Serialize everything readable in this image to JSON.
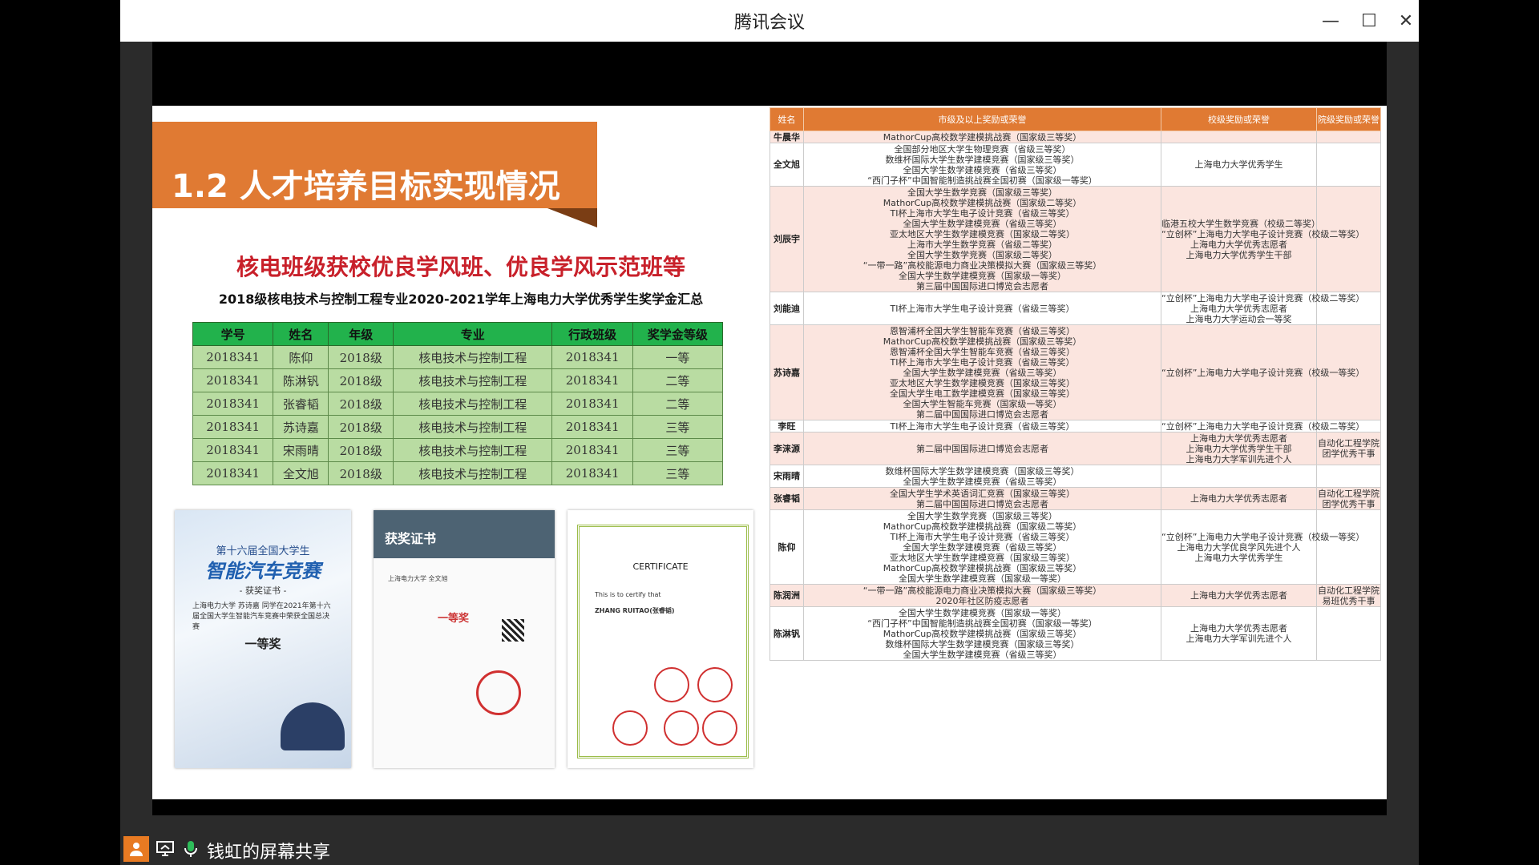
{
  "window": {
    "title": "腾讯会议",
    "minimize": "—",
    "maximize": "☐",
    "close": "✕"
  },
  "slide": {
    "banner_title": "1.2 人才培养目标实现情况",
    "red_heading": "核电班级获校优良学风班、优良学风示范班等",
    "sub_heading": "2018级核电技术与控制工程专业2020-2021学年上海电力大学优秀学生奖学金汇总",
    "scholarship": {
      "headers": [
        "学号",
        "姓名",
        "年级",
        "专业",
        "行政班级",
        "奖学金等级"
      ],
      "rows": [
        [
          "2018341",
          "陈仰",
          "2018级",
          "核电技术与控制工程",
          "2018341",
          "一等"
        ],
        [
          "2018341",
          "陈淋钒",
          "2018级",
          "核电技术与控制工程",
          "2018341",
          "二等"
        ],
        [
          "2018341",
          "张睿韬",
          "2018级",
          "核电技术与控制工程",
          "2018341",
          "二等"
        ],
        [
          "2018341",
          "苏诗嘉",
          "2018级",
          "核电技术与控制工程",
          "2018341",
          "三等"
        ],
        [
          "2018341",
          "宋雨晴",
          "2018级",
          "核电技术与控制工程",
          "2018341",
          "三等"
        ],
        [
          "2018341",
          "全文旭",
          "2018级",
          "核电技术与控制工程",
          "2018341",
          "三等"
        ]
      ]
    },
    "cert1": {
      "top": "第十六届全国大学生",
      "big": "智能汽车竞赛",
      "small": "- 获奖证书 -",
      "text": "上海电力大学 苏诗嘉 同学在2021年第十六届全国大学生智能汽车竞赛中荣获全国总决赛",
      "prize": "一等奖"
    },
    "cert2": {
      "head": "获奖证书",
      "text": "上海电力大学 全文旭",
      "prize": "一等奖"
    },
    "cert3": {
      "title": "CERTIFICATE",
      "text": "This is to certify that",
      "name": "ZHANG RUITAO(张睿韬)"
    },
    "awards": {
      "headers": [
        "姓名",
        "市级及以上奖励或荣誉",
        "校级奖励或荣誉",
        "院级奖励或荣誉"
      ],
      "rows": [
        {
          "name": "牛晨华",
          "city": [
            "MathorCup高校数学建模挑战赛（国家级三等奖）"
          ],
          "school": [],
          "college": []
        },
        {
          "name": "全文旭",
          "city": [
            "全国部分地区大学生物理竞赛（省级三等奖）",
            "数维杯国际大学生数学建模竞赛（国家级三等奖）",
            "全国大学生数学建模竞赛（省级三等奖）",
            "“西门子杯”中国智能制造挑战赛全国初赛（国家级一等奖）"
          ],
          "school": [
            "上海电力大学优秀学生"
          ],
          "college": []
        },
        {
          "name": "刘辰宇",
          "city": [
            "全国大学生数学竞赛（国家级三等奖）",
            "MathorCup高校数学建模挑战赛（国家级二等奖）",
            "TI杯上海市大学生电子设计竞赛（省级三等奖）",
            "全国大学生数学建模竞赛（省级三等奖）",
            "亚太地区大学生数学建模竞赛（国家级二等奖）",
            "上海市大学生数学竞赛（省级二等奖）",
            "全国大学生数学竞赛（国家级二等奖）",
            "“一带一路”高校能源电力商业决策模拟大赛（国家级三等奖）",
            "全国大学生数学建模竞赛（国家级一等奖）",
            "第三届中国国际进口博览会志愿者"
          ],
          "school": [
            "临港五校大学生数学竞赛（校级二等奖）",
            "“立创杯”上海电力大学电子设计竞赛（校级二等奖）",
            "上海电力大学优秀志愿者",
            "上海电力大学优秀学生干部"
          ],
          "college": []
        },
        {
          "name": "刘能迪",
          "city": [
            "TI杯上海市大学生电子设计竞赛（省级三等奖）"
          ],
          "school": [
            "“立创杯”上海电力大学电子设计竞赛（校级二等奖）",
            "上海电力大学优秀志愿者",
            "上海电力大学运动会一等奖"
          ],
          "college": []
        },
        {
          "name": "苏诗嘉",
          "city": [
            "恩智浦杯全国大学生智能车竞赛（省级三等奖）",
            "MathorCup高校数学建模挑战赛（国家级三等奖）",
            "恩智浦杯全国大学生智能车竞赛（省级三等奖）",
            "TI杯上海市大学生电子设计竞赛（省级三等奖）",
            "全国大学生数学建模竞赛（省级三等奖）",
            "亚太地区大学生数学建模竞赛（国家级三等奖）",
            "全国大学生电工数学建模竞赛（国家级三等奖）",
            "全国大学生智能车竞赛（国家级一等奖）",
            "第二届中国国际进口博览会志愿者"
          ],
          "school": [
            "“立创杯”上海电力大学电子设计竞赛（校级一等奖）"
          ],
          "college": []
        },
        {
          "name": "李旺",
          "city": [
            "TI杯上海市大学生电子设计竞赛（省级三等奖）"
          ],
          "school": [
            "“立创杯”上海电力大学电子设计竞赛（校级二等奖）"
          ],
          "college": []
        },
        {
          "name": "李涞源",
          "city": [
            "第二届中国国际进口博览会志愿者"
          ],
          "school": [
            "上海电力大学优秀志愿者",
            "上海电力大学优秀学生干部",
            "上海电力大学军训先进个人"
          ],
          "college": [
            "自动化工程学院",
            "团学优秀干事"
          ]
        },
        {
          "name": "宋雨晴",
          "city": [
            "数维杯国际大学生数学建模竞赛（国家级三等奖）",
            "全国大学生数学建模竞赛（省级三等奖）"
          ],
          "school": [],
          "college": []
        },
        {
          "name": "张睿韬",
          "city": [
            "全国大学生学术英语词汇竞赛（国家级三等奖）",
            "第二届中国国际进口博览会志愿者"
          ],
          "school": [
            "上海电力大学优秀志愿者"
          ],
          "college": [
            "自动化工程学院",
            "团学优秀干事"
          ]
        },
        {
          "name": "陈仰",
          "city": [
            "全国大学生数学竞赛（国家级三等奖）",
            "MathorCup高校数学建模挑战赛（国家级二等奖）",
            "TI杯上海市大学生电子设计竞赛（省级三等奖）",
            "全国大学生数学建模竞赛（省级三等奖）",
            "亚太地区大学生数学建模竞赛（国家级三等奖）",
            "MathorCup高校数学建模挑战赛（国家级三等奖）",
            "全国大学生数学建模竞赛（国家级一等奖）"
          ],
          "school": [
            "“立创杯”上海电力大学电子设计竞赛（校级一等奖）",
            "上海电力大学优良学风先进个人",
            "上海电力大学优秀学生"
          ],
          "college": []
        },
        {
          "name": "陈润洲",
          "city": [
            "“一带一路”高校能源电力商业决策模拟大赛（国家级三等奖）",
            "2020年社区防疫志愿者"
          ],
          "school": [
            "上海电力大学优秀志愿者"
          ],
          "college": [
            "自动化工程学院",
            "易班优秀干事"
          ]
        },
        {
          "name": "陈淋钒",
          "city": [
            "全国大学生数学建模竞赛（国家级一等奖）",
            "“西门子杯”中国智能制造挑战赛全国初赛（国家级一等奖）",
            "MathorCup高校数学建模挑战赛（国家级三等奖）",
            "数维杯国际大学生数学建模竞赛（国家级三等奖）",
            "全国大学生数学建模竞赛（省级三等奖）"
          ],
          "school": [
            "上海电力大学优秀志愿者",
            "上海电力大学军训先进个人"
          ],
          "college": []
        }
      ]
    }
  },
  "share_bar": {
    "text": "钱虹的屏幕共享",
    "icons": [
      "user-icon",
      "screen-share-icon",
      "microphone-icon"
    ]
  },
  "colors": {
    "banner": "#e07a33",
    "red_heading": "#c8202a",
    "table_header": "#22b24c",
    "table_cell": "#b9dca2"
  }
}
